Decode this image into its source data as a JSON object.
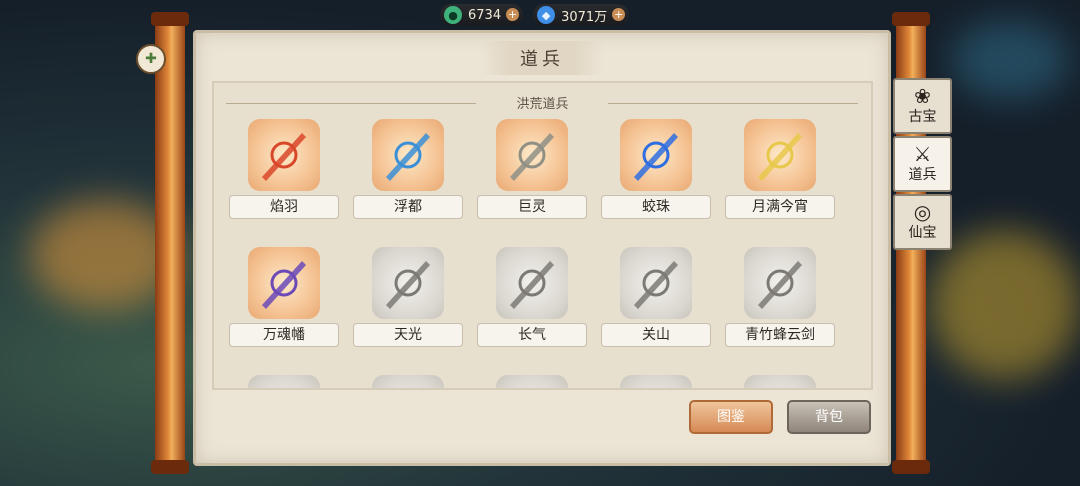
{
  "currencies": [
    {
      "name": "jade-icon",
      "value": "6734",
      "color": "#3fb27c"
    },
    {
      "name": "spirit-water-icon",
      "value": "3071万",
      "color": "#3f8ee8"
    }
  ],
  "panel": {
    "title": "道兵",
    "section_title": "洪荒道兵"
  },
  "items": [
    {
      "name": "焰羽",
      "owned": true,
      "icon": "flame-feather-sword-icon",
      "color": "#d9472a"
    },
    {
      "name": "浮都",
      "owned": true,
      "icon": "floating-city-sword-icon",
      "color": "#3a8fd6"
    },
    {
      "name": "巨灵",
      "owned": true,
      "icon": "giant-spirit-icon",
      "color": "#8f8f86"
    },
    {
      "name": "蛟珠",
      "owned": true,
      "icon": "dragon-pearl-icon",
      "color": "#2f6ee0"
    },
    {
      "name": "月满今宵",
      "owned": true,
      "icon": "full-moon-icon",
      "color": "#e7c84a"
    },
    {
      "name": "万魂幡",
      "owned": true,
      "icon": "soul-banner-icon",
      "color": "#6b4ab8"
    },
    {
      "name": "天光",
      "owned": false,
      "icon": "sky-light-sword-icon",
      "color": "#888888"
    },
    {
      "name": "长气",
      "owned": false,
      "icon": "long-breath-sword-icon",
      "color": "#888888"
    },
    {
      "name": "关山",
      "owned": false,
      "icon": "mountain-pass-sword-icon",
      "color": "#888888"
    },
    {
      "name": "青竹蜂云剑",
      "owned": false,
      "icon": "bamboo-cloud-sword-icon",
      "color": "#888888"
    }
  ],
  "buttons": {
    "atlas": "图鉴",
    "bag": "背包"
  },
  "tabs": [
    {
      "label": "古宝",
      "icon": "ancient-treasure-icon",
      "glyph": "❀"
    },
    {
      "label": "道兵",
      "icon": "dao-weapon-icon",
      "glyph": "⚔"
    },
    {
      "label": "仙宝",
      "icon": "immortal-treasure-icon",
      "glyph": "◎"
    }
  ]
}
